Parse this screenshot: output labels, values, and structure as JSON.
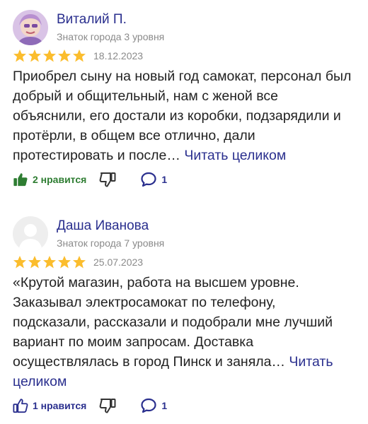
{
  "reviews": [
    {
      "author": "Виталий П.",
      "level": "Знаток города 3 уровня",
      "rating": 5,
      "date": "18.12.2023",
      "text": "Приобрел сыну на новый год самокат, персонал был добрый и общительный, нам с женой все объяснили, его достали из коробки, подзарядили и протёрли, в общем все отлично, дали протестировать и после…",
      "read_more": "Читать целиком",
      "likes_label": "2 нравится",
      "comments_count": "1",
      "liked": true
    },
    {
      "author": "Даша Иванова",
      "level": "Знаток города 7 уровня",
      "rating": 5,
      "date": "25.07.2023",
      "text": "«Крутой магазин, работа на высшем уровне. Заказывал электросамокат по телефону, подсказали, рассказали и подобрали мне лучший вариант по моим запросам. Доставка осуществлялась в город Пинск и заняла…",
      "read_more": "Читать целиком",
      "likes_label": "1 нравится",
      "comments_count": "1",
      "liked": false
    }
  ],
  "colors": {
    "accent": "#2a2f8e",
    "star": "#fbbd2d",
    "liked": "#2e7d32",
    "muted": "#8a8a8a",
    "text": "#222222"
  },
  "icons": {
    "like": "thumbs-up-icon",
    "dislike": "thumbs-down-icon",
    "comment": "comment-bubble-icon",
    "star": "star-icon"
  }
}
